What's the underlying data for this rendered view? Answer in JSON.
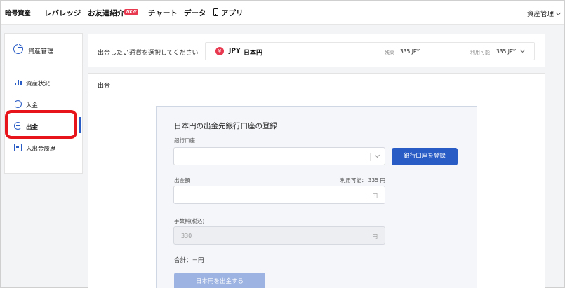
{
  "nav": {
    "items": [
      "暗号資産",
      "レバレッジ",
      "お友達紹介",
      "チャート",
      "データ",
      "アプリ"
    ],
    "new_badge": "NEW",
    "right_menu": "資産管理"
  },
  "sidebar": {
    "header": "資産管理",
    "items": [
      {
        "label": "資産状況",
        "icon": "bar-chart-icon"
      },
      {
        "label": "入金",
        "icon": "deposit-icon"
      },
      {
        "label": "出金",
        "icon": "withdraw-icon",
        "active": true
      },
      {
        "label": "入出金履歴",
        "icon": "history-icon"
      }
    ]
  },
  "currency": {
    "prompt": "出金したい通貨を選択してください",
    "icon_symbol": "¥",
    "code": "JPY",
    "name": "日本円",
    "balance_label": "残高",
    "balance": "335 JPY",
    "available_label": "利用可能",
    "available": "335 JPY"
  },
  "main": {
    "title": "出金",
    "form": {
      "title": "日本円の出金先銀行口座の登録",
      "bank_label": "銀行口座",
      "register_button": "銀行口座を登録",
      "amount_label": "出金額",
      "amount_available": "利用可能： 335 円",
      "amount_unit": "円",
      "fee_label": "手数料(税込)",
      "fee_value": "330",
      "fee_unit": "円",
      "total": "合計：－円",
      "submit_button": "日本円を出金する"
    }
  },
  "colors": {
    "accent": "#2a5cc6",
    "highlight": "#e8141c",
    "badge": "#e8384f",
    "submit_disabled": "#9db3e2"
  }
}
